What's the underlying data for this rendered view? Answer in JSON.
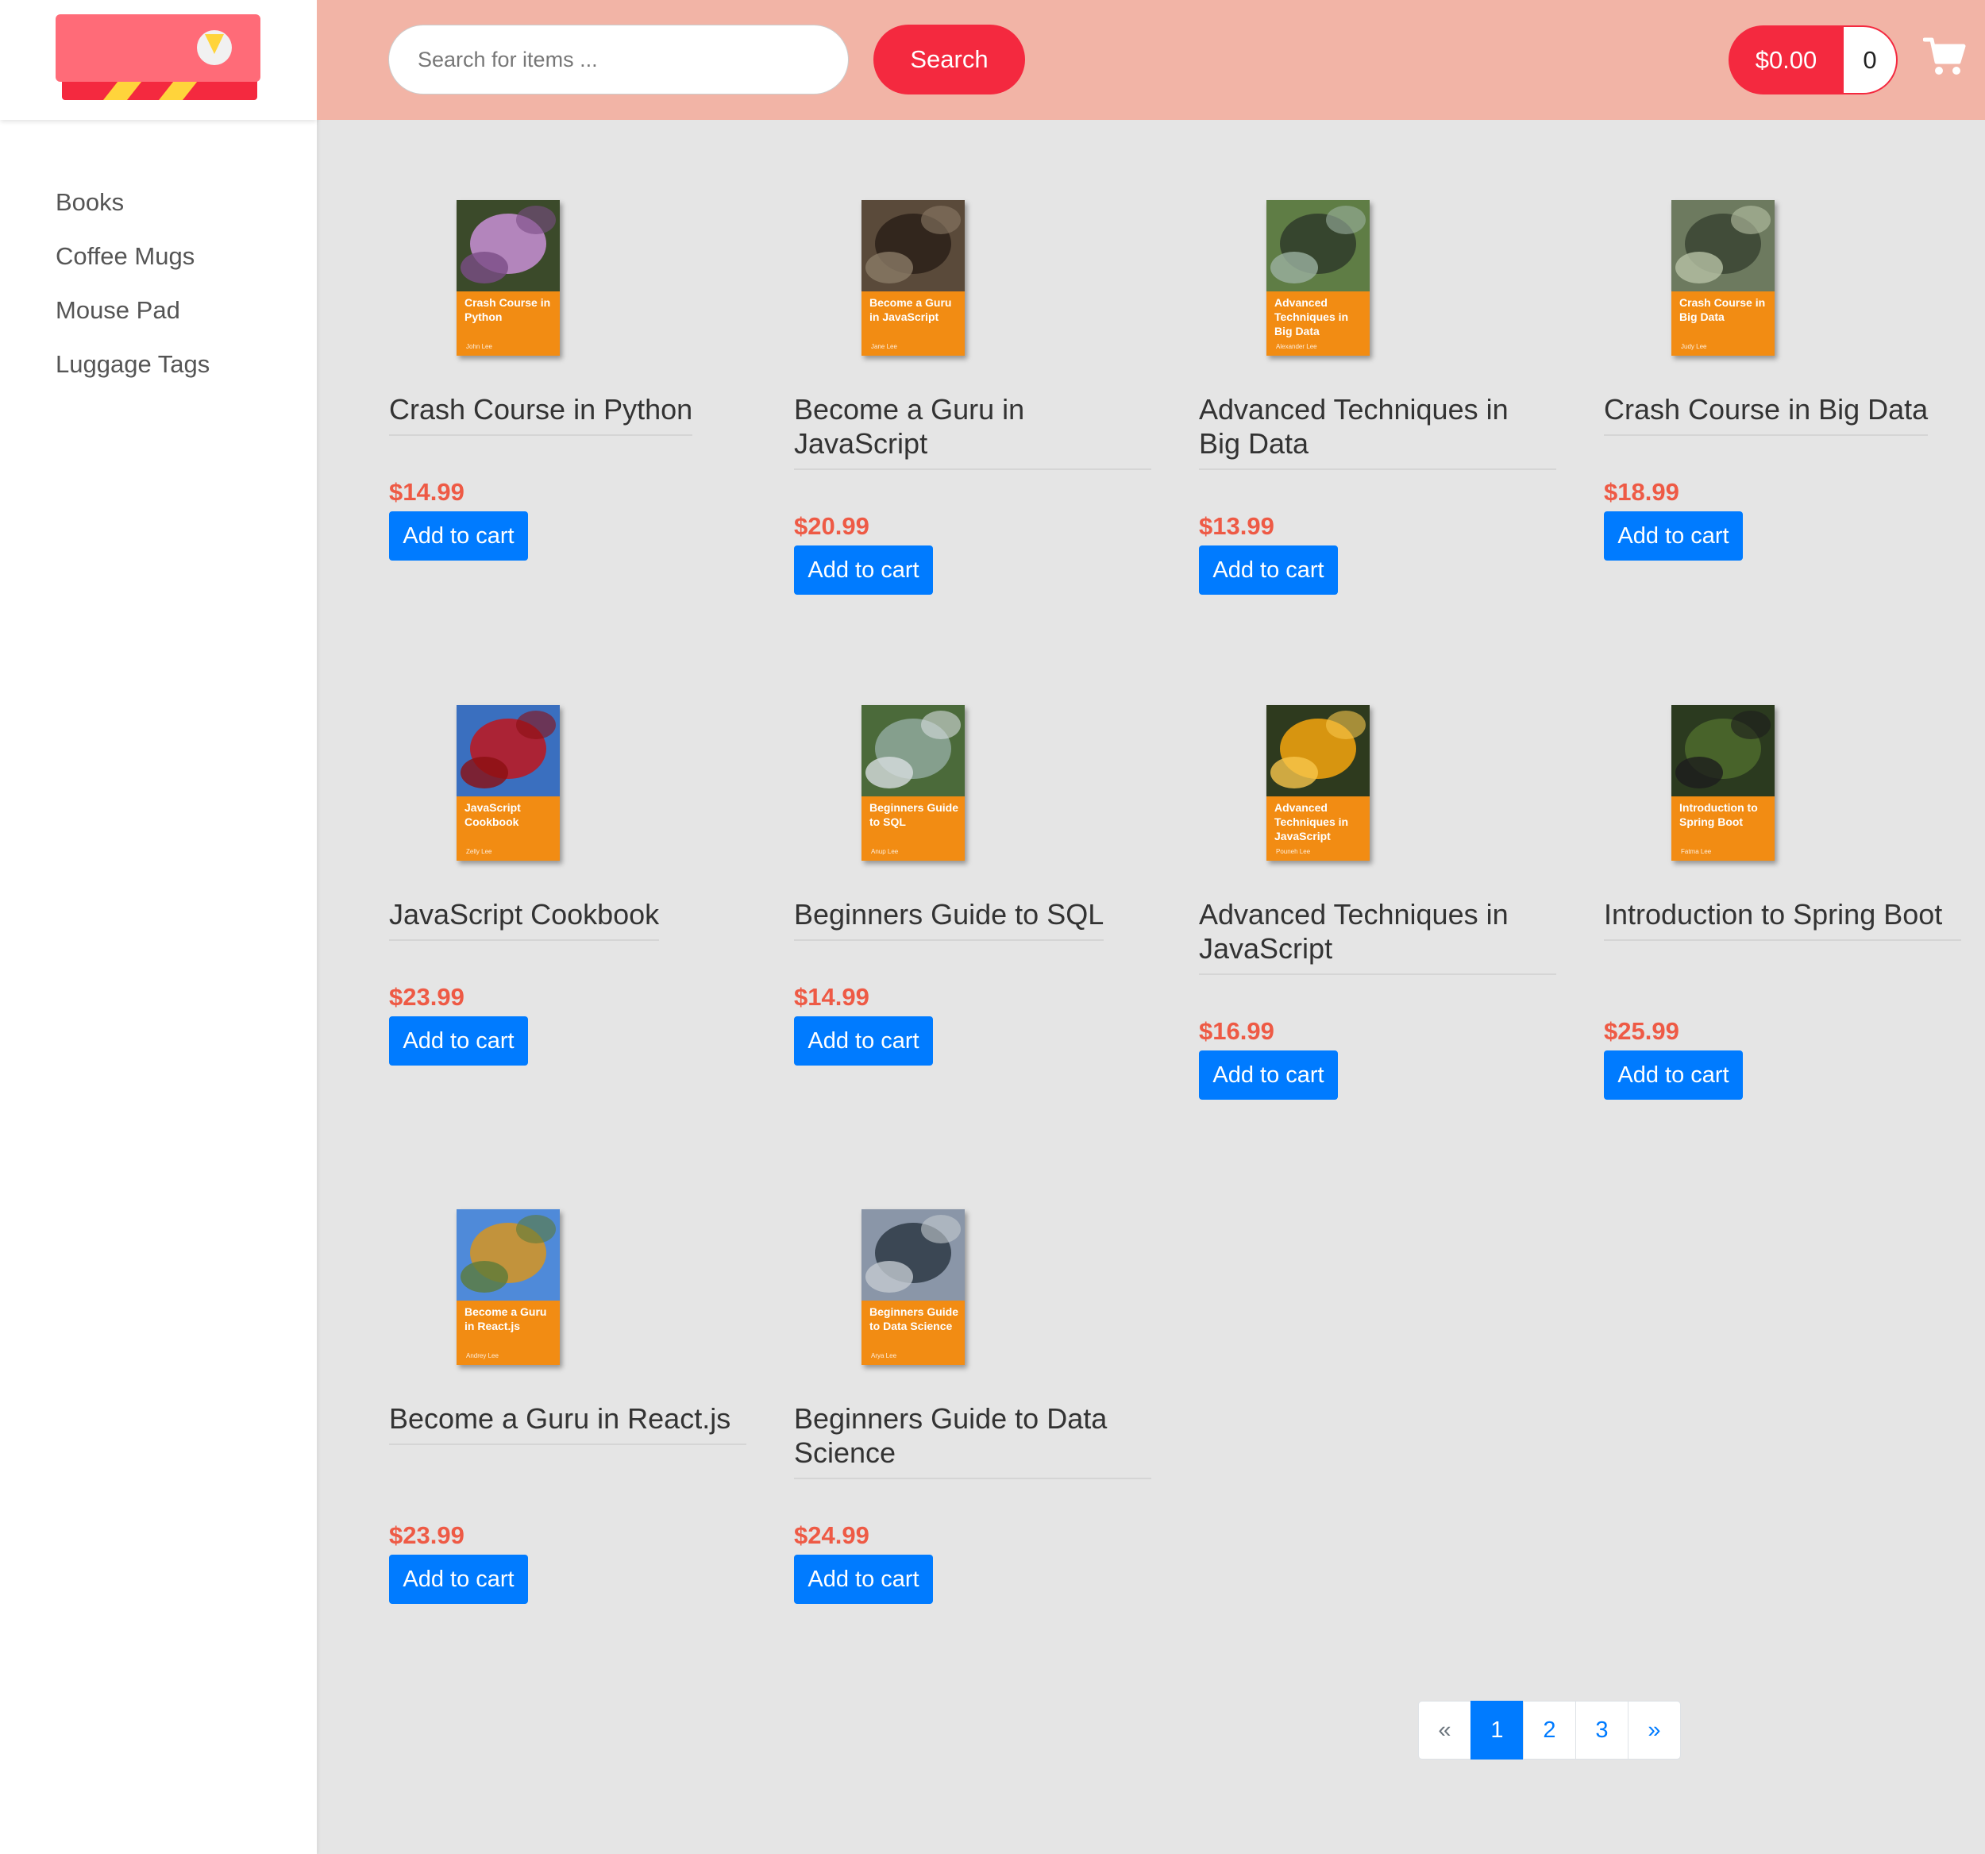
{
  "sidebar": {
    "categories": [
      "Books",
      "Coffee Mugs",
      "Mouse Pad",
      "Luggage Tags"
    ]
  },
  "header": {
    "search_placeholder": "Search for items ...",
    "search_label": "Search",
    "cart_total": "$0.00",
    "cart_count": "0"
  },
  "colors": {
    "header_bg": "#f2b4a6",
    "brand_red": "#f4293f",
    "price": "#ee5a45",
    "button_blue": "#007bff",
    "cover_orange": "#f28c13"
  },
  "products": [
    {
      "title": "Crash Course in Python",
      "price": "$14.99",
      "button": "Add to cart",
      "cover_title": "Crash Course in Python",
      "cover_author": "John Lee"
    },
    {
      "title": "Become a Guru in JavaScript",
      "price": "$20.99",
      "button": "Add to cart",
      "cover_title": "Become a Guru in JavaScript",
      "cover_author": "Jane Lee"
    },
    {
      "title": "Advanced Techniques in Big Data",
      "price": "$13.99",
      "button": "Add to cart",
      "cover_title": "Advanced Techniques in Big Data",
      "cover_author": "Alexander Lee"
    },
    {
      "title": "Crash Course in Big Data",
      "price": "$18.99",
      "button": "Add to cart",
      "cover_title": "Crash Course in Big Data",
      "cover_author": "Judy Lee"
    },
    {
      "title": "JavaScript Cookbook",
      "price": "$23.99",
      "button": "Add to cart",
      "cover_title": "JavaScript Cookbook",
      "cover_author": "Zelly Lee"
    },
    {
      "title": "Beginners Guide to SQL",
      "price": "$14.99",
      "button": "Add to cart",
      "cover_title": "Beginners Guide to SQL",
      "cover_author": "Anup Lee"
    },
    {
      "title": "Advanced Techniques in JavaScript",
      "price": "$16.99",
      "button": "Add to cart",
      "cover_title": "Advanced Techniques in JavaScript",
      "cover_author": "Pouneh Lee"
    },
    {
      "title": "Introduction to Spring Boot",
      "price": "$25.99",
      "button": "Add to cart",
      "cover_title": "Introduction to Spring Boot",
      "cover_author": "Fatma Lee"
    },
    {
      "title": "Become a Guru in React.js",
      "price": "$23.99",
      "button": "Add to cart",
      "cover_title": "Become a Guru in React.js",
      "cover_author": "Andrey Lee"
    },
    {
      "title": "Beginners Guide to Data Science",
      "price": "$24.99",
      "button": "Add to cart",
      "cover_title": "Beginners Guide to Data Science",
      "cover_author": "Arya Lee"
    }
  ],
  "pagination": {
    "prev": "«",
    "pages": [
      "1",
      "2",
      "3"
    ],
    "active": "1",
    "next": "»"
  }
}
